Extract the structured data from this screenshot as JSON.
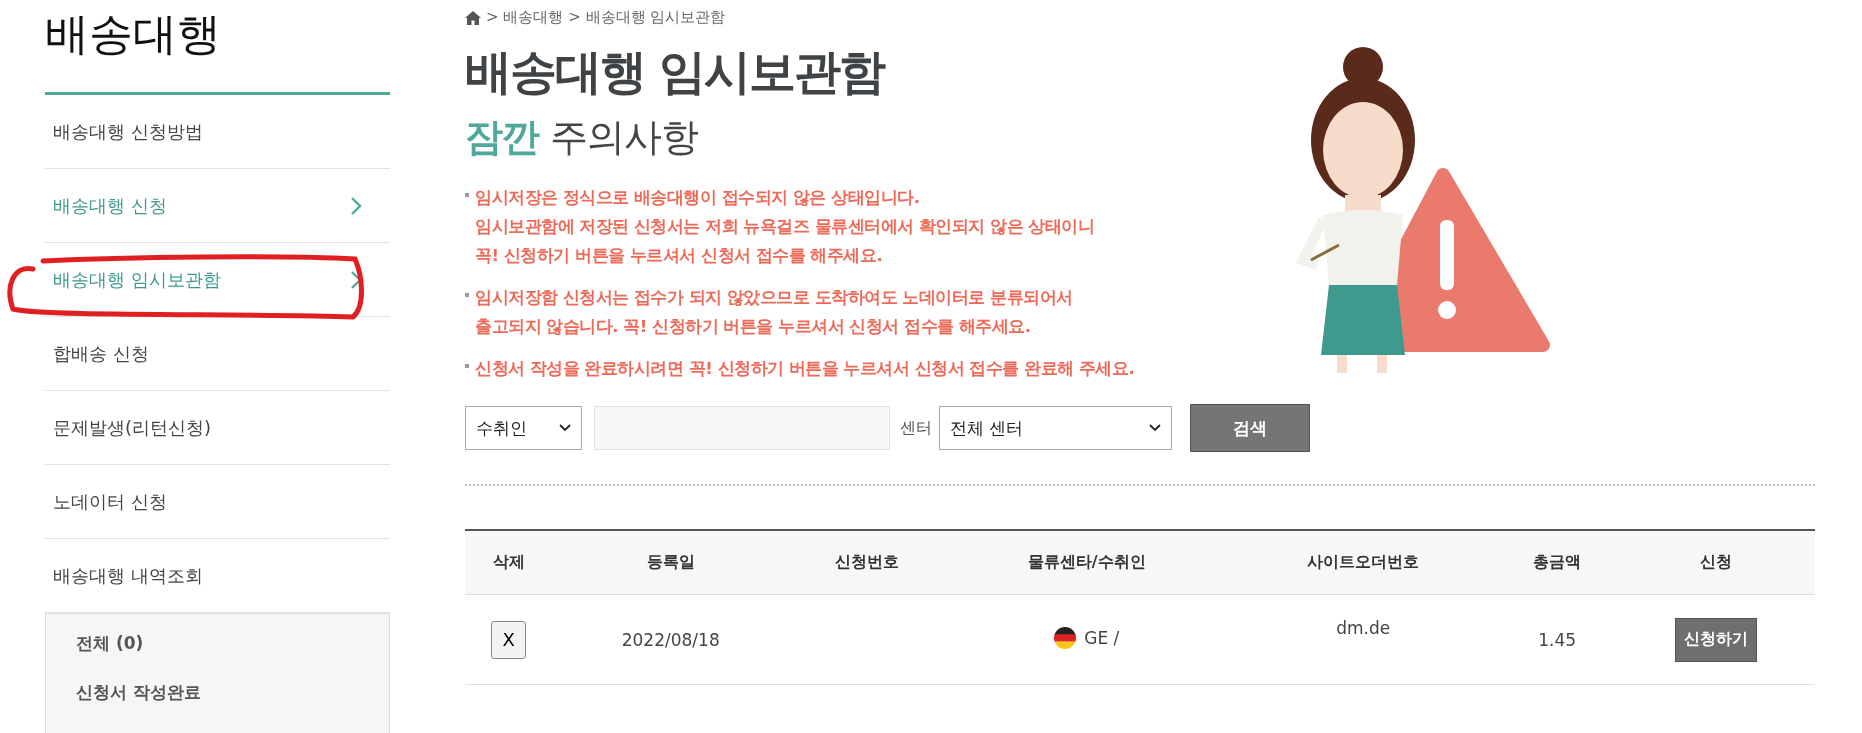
{
  "sidebar": {
    "title": "배송대행",
    "items": [
      {
        "label": "배송대행 신청방법",
        "highlighted": false
      },
      {
        "label": "배송대행 신청",
        "highlighted": true
      },
      {
        "label": "배송대행 임시보관함",
        "highlighted": true
      },
      {
        "label": "합배송 신청",
        "highlighted": false
      },
      {
        "label": "문제발생(리턴신청)",
        "highlighted": false
      },
      {
        "label": "노데이터 신청",
        "highlighted": false
      },
      {
        "label": "배송대행 내역조회",
        "highlighted": false
      }
    ],
    "status_box": {
      "total": "전체 (0)",
      "group": "신청서 작성완료"
    }
  },
  "breadcrumb": [
    "> 배송대행",
    "> 배송대행 임시보관함"
  ],
  "heading": "배송대행 임시보관함",
  "subheading": {
    "accent": "잠깐",
    "rest": "주의사항"
  },
  "notes": [
    [
      "임시저장은 정식으로 배송대행이 접수되지 않은 상태입니다.",
      "임시보관함에 저장된 신청서는 저희 뉴욕걸즈 물류센터에서 확인되지 않은 상태이니",
      "꼭! 신청하기 버튼을 누르셔서 신청서 접수를 해주세요."
    ],
    [
      "임시저장함 신청서는 접수가 되지 않았으므로 도착하여도 노데이터로 분류되어서",
      "출고되지 않습니다. 꼭! 신청하기 버튼을 누르셔서 신청서 접수를 해주세요."
    ],
    [
      "신청서 작성을 완료하시려면 꼭! 신청하기 버튼을 누르셔서 신청서 접수를 완료해 주세요."
    ]
  ],
  "search": {
    "field_select": "수취인",
    "center_label": "센터",
    "center_select": "전체 센터",
    "button": "검색"
  },
  "table": {
    "columns": [
      "삭제",
      "등록일",
      "신청번호",
      "물류센타/수취인",
      "사이트오더번호",
      "총금액",
      "신청"
    ],
    "rows": [
      {
        "delete": "X",
        "date": "2022/08/18",
        "center": "GE /",
        "site": "dm.de",
        "amount": "1.45",
        "action": "신청하기"
      }
    ]
  }
}
